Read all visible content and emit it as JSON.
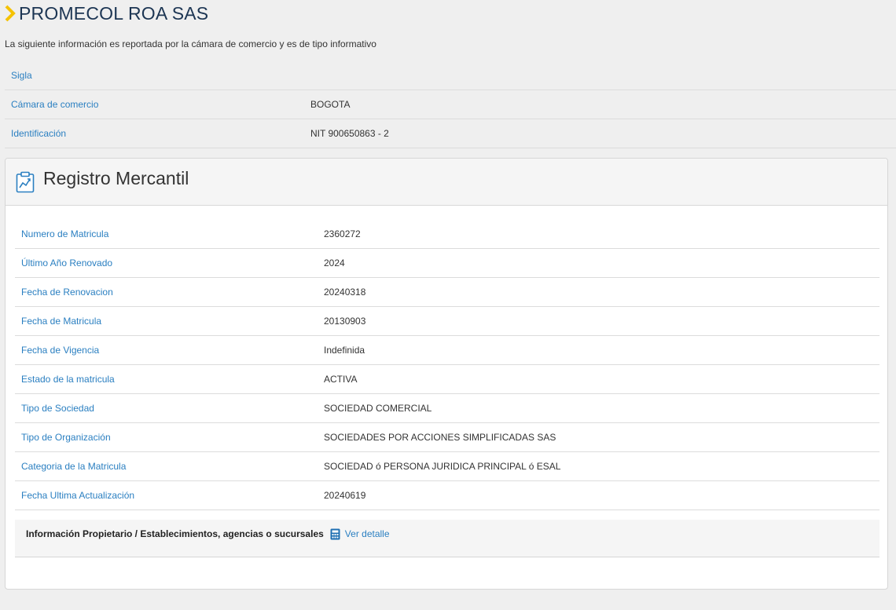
{
  "header": {
    "title": "PROMECOL ROA SAS"
  },
  "intro": "La siguiente información es reportada por la cámara de comercio y es de tipo informativo",
  "info": [
    {
      "label": "Sigla",
      "value": ""
    },
    {
      "label": "Cámara de comercio",
      "value": "BOGOTA"
    },
    {
      "label": "Identificación",
      "value": "NIT 900650863 - 2"
    }
  ],
  "panel": {
    "title": "Registro Mercantil",
    "rows": [
      {
        "label": "Numero de Matricula",
        "value": "2360272"
      },
      {
        "label": "Último Año Renovado",
        "value": "2024"
      },
      {
        "label": "Fecha de Renovacion",
        "value": "20240318"
      },
      {
        "label": "Fecha de Matricula",
        "value": "20130903"
      },
      {
        "label": "Fecha de Vigencia",
        "value": "Indefinida"
      },
      {
        "label": "Estado de la matricula",
        "value": "ACTIVA"
      },
      {
        "label": "Tipo de Sociedad",
        "value": "SOCIEDAD COMERCIAL"
      },
      {
        "label": "Tipo de Organización",
        "value": "SOCIEDADES POR ACCIONES SIMPLIFICADAS SAS"
      },
      {
        "label": "Categoria de la Matricula",
        "value": "SOCIEDAD ó PERSONA JURIDICA PRINCIPAL ó ESAL"
      },
      {
        "label": "Fecha Ultima Actualización",
        "value": "20240619"
      }
    ],
    "footer": {
      "label": "Información Propietario / Establecimientos, agencias o sucursales",
      "link": "Ver detalle"
    }
  },
  "colors": {
    "accent_yellow": "#f5c200",
    "link_blue": "#2a7fc1",
    "title_navy": "#1c3553"
  },
  "icons": {
    "title_marker": "chevron-right-icon",
    "panel_icon": "clipboard-chart-icon",
    "detail_icon": "calculator-icon"
  }
}
